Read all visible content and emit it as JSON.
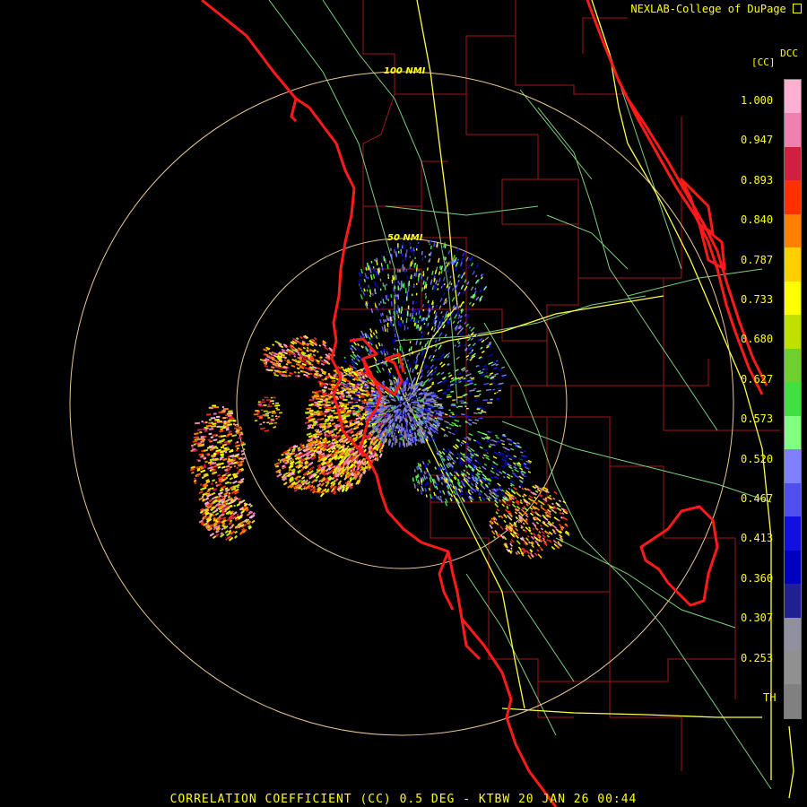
{
  "credit": "NEXLAB-College of DuPage",
  "product_code": "DCC",
  "unit_label": "[CC]",
  "footer": "CORRELATION COEFFICIENT (CC) 0.5 DEG - KTBW 20 JAN 26 00:44",
  "range_rings": [
    "50 NMI",
    "100 NMI"
  ],
  "scale_labels": [
    "1.000",
    "0.947",
    "0.893",
    "0.840",
    "0.787",
    "0.733",
    "0.680",
    "0.627",
    "0.573",
    "0.520",
    "0.467",
    "0.413",
    "0.360",
    "0.307",
    "0.253",
    "TH"
  ],
  "colorbar_colors": [
    "#ffb0d0",
    "#f080b0",
    "#d02040",
    "#ff3000",
    "#ff8000",
    "#ffd000",
    "#ffff00",
    "#c0e000",
    "#70d030",
    "#40e040",
    "#80ff80",
    "#8080ff",
    "#5050f0",
    "#1010e0",
    "#0000c0",
    "#202090",
    "#9090a0",
    "#909090",
    "#808080"
  ],
  "colors": {
    "coastline": "#ff1a1a",
    "county": "#a01818",
    "highway": "#ffff44",
    "road": "#7ecf7e",
    "ring": "#e8c890",
    "text": "#ffff00"
  }
}
